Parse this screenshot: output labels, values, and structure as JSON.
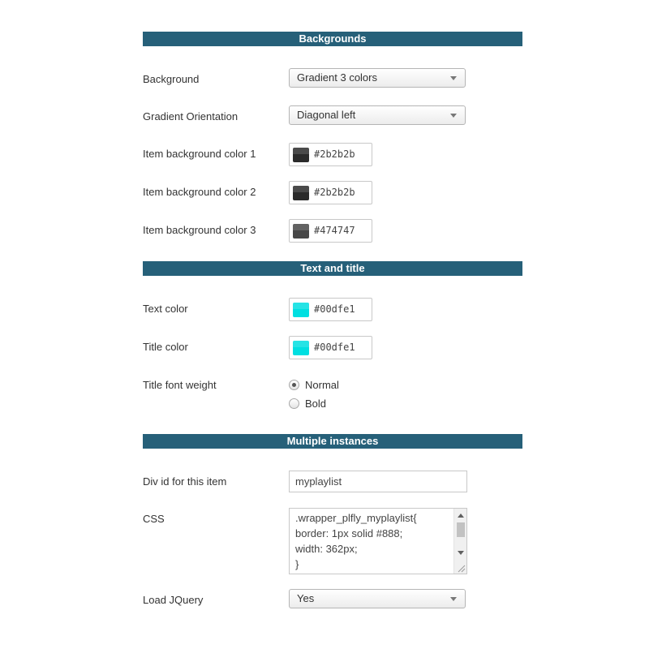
{
  "sections": {
    "backgrounds": "Backgrounds",
    "text_and_title": "Text and title",
    "multiple_instances": "Multiple instances"
  },
  "background": {
    "label": "Background",
    "value": "Gradient 3 colors"
  },
  "gradient_orientation": {
    "label": "Gradient Orientation",
    "value": "Diagonal left"
  },
  "item_bg_color_1": {
    "label": "Item background color 1",
    "value": "#2b2b2b",
    "color": "#2b2b2b"
  },
  "item_bg_color_2": {
    "label": "Item background color 2",
    "value": "#2b2b2b",
    "color": "#2b2b2b"
  },
  "item_bg_color_3": {
    "label": "Item background color 3",
    "value": "#474747",
    "color": "#474747"
  },
  "text_color": {
    "label": "Text color",
    "value": "#00dfe1",
    "color": "#00dfe1"
  },
  "title_color": {
    "label": "Title color",
    "value": "#00dfe1",
    "color": "#00dfe1"
  },
  "title_font_weight": {
    "label": "Title font weight",
    "options": [
      "Normal",
      "Bold"
    ],
    "selected": "Normal"
  },
  "div_id": {
    "label": "Div id for this item",
    "value": "myplaylist"
  },
  "css": {
    "label": "CSS",
    "value": ".wrapper_plfly_myplaylist{\nborder: 1px solid #888;\nwidth: 362px;\n}"
  },
  "load_jquery": {
    "label": "Load JQuery",
    "value": "Yes"
  },
  "colors": {
    "header_bg": "#266079",
    "header_text": "#ffffff"
  }
}
